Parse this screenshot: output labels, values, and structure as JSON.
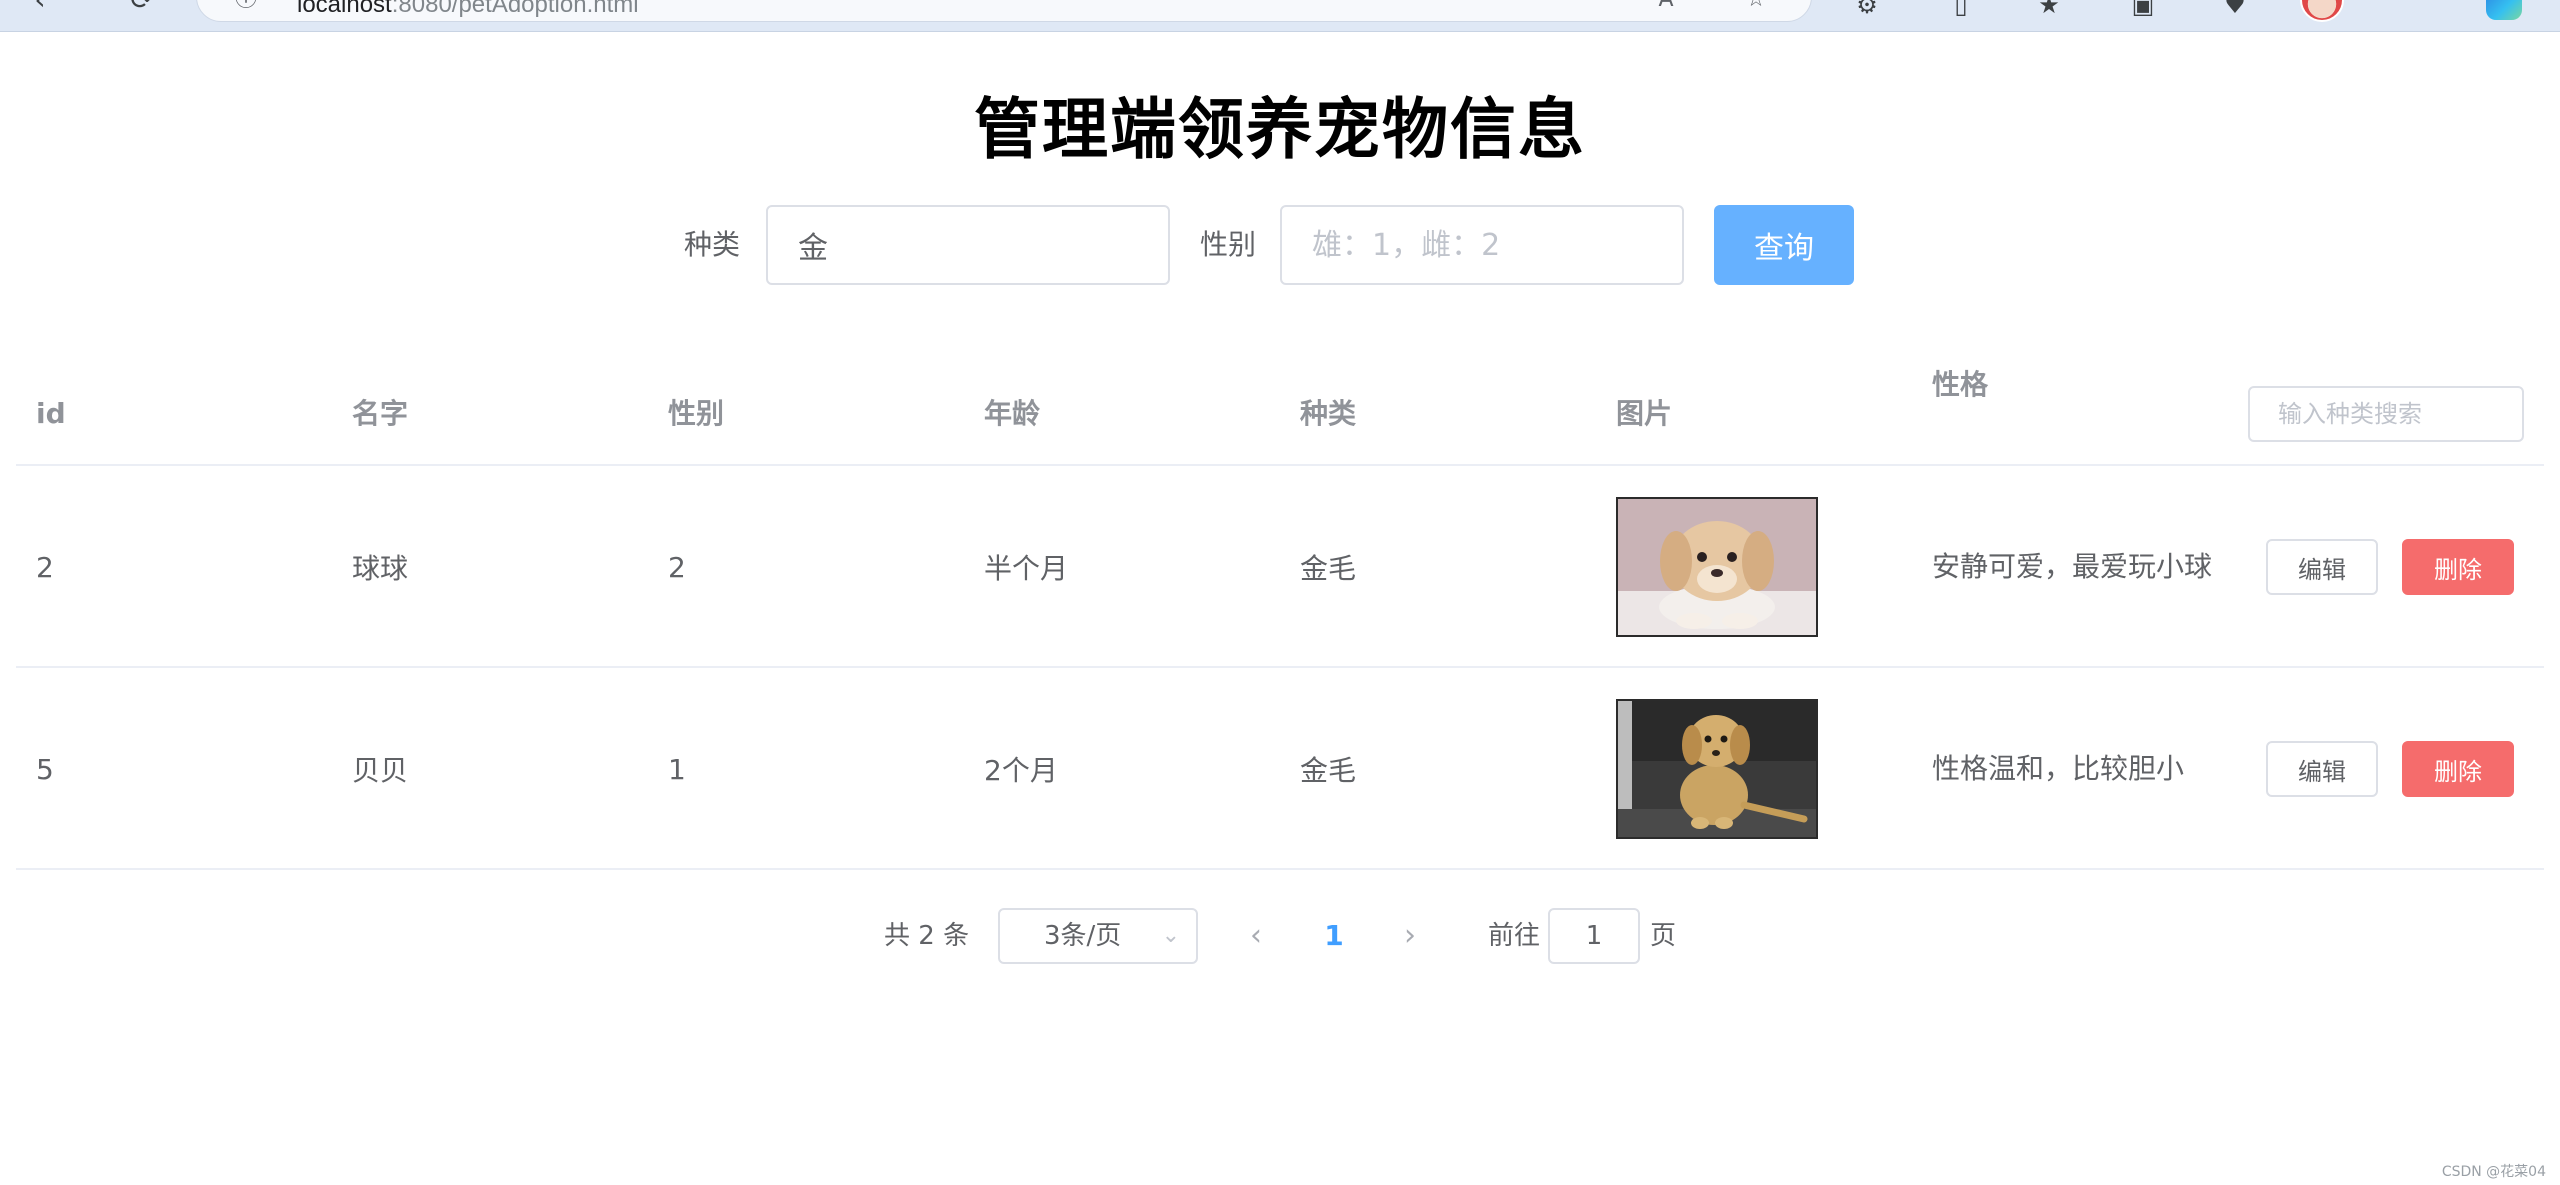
{
  "browser": {
    "url_host": "localhost",
    "url_rest": ":8080/petAdoption.html",
    "back_icon": "back-arrow-icon",
    "refresh_icon": "refresh-icon"
  },
  "page": {
    "title": "管理端领养宠物信息"
  },
  "search": {
    "kind_label": "种类",
    "kind_value": "金",
    "sex_label": "性别",
    "sex_placeholder": "雄：1，雌：2",
    "query_label": "查询"
  },
  "table": {
    "headers": {
      "id": "id",
      "name": "名字",
      "sex": "性别",
      "age": "年龄",
      "kind": "种类",
      "picture": "图片",
      "trait": "性格"
    },
    "header_search_placeholder": "输入种类搜索",
    "rows": [
      {
        "id": "2",
        "name": "球球",
        "sex": "2",
        "age": "半个月",
        "kind": "金毛",
        "picture": "puppy-photo-white-bg",
        "trait": "安静可爱，最爱玩小球",
        "edit": "编辑",
        "delete": "删除"
      },
      {
        "id": "5",
        "name": "贝贝",
        "sex": "1",
        "age": "2个月",
        "kind": "金毛",
        "picture": "puppy-photo-dark-bg",
        "trait": "性格温和，比较胆小",
        "edit": "编辑",
        "delete": "删除"
      }
    ]
  },
  "pagination": {
    "total": "共 2 条",
    "page_size": "3条/页",
    "current_page": "1",
    "goto_label": "前往",
    "goto_value": "1",
    "goto_suffix": "页"
  },
  "watermark": "CSDN @花菜04",
  "colors": {
    "primary_light": "#66b1ff",
    "primary": "#409eff",
    "danger": "#f56c6c",
    "border": "#dcdfe6"
  }
}
